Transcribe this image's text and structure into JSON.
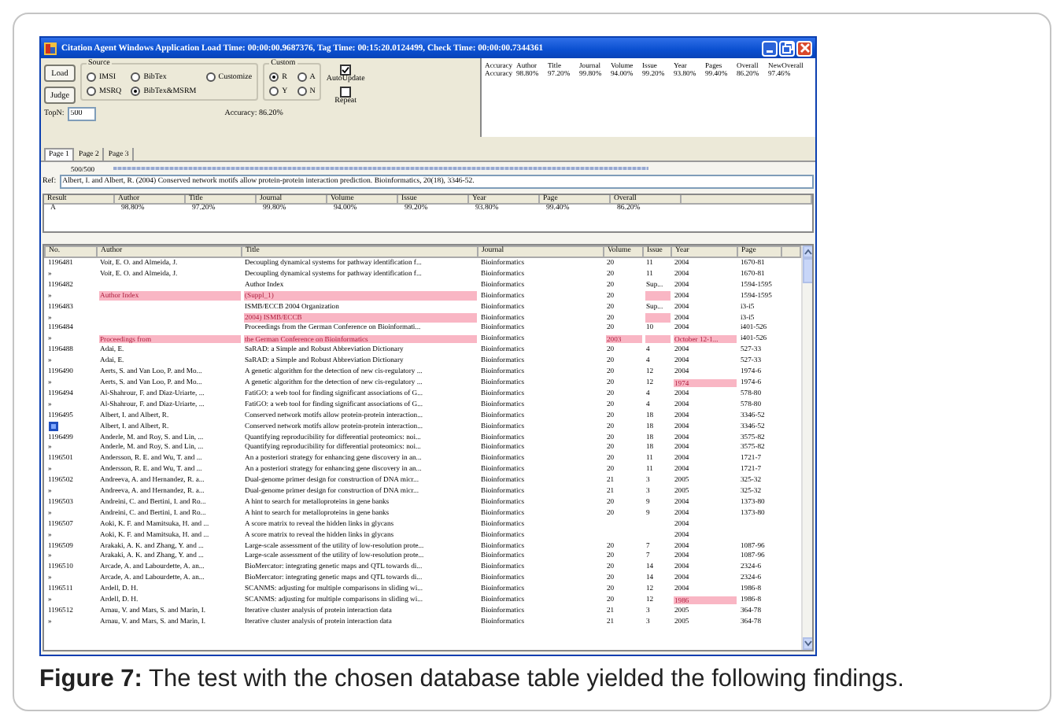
{
  "window": {
    "title": "Citation Agent Windows Application Load Time: 00:00:00.9687376, Tag Time: 00:15:20.0124499, Check Time: 00:00:00.7344361"
  },
  "controls": {
    "buttons": [
      "Load",
      "Judge"
    ],
    "source": {
      "label": "Source",
      "options": [
        {
          "label": "IMSI",
          "selected": false
        },
        {
          "label": "BibTex",
          "selected": false
        },
        {
          "label": "Customize",
          "selected": false
        },
        {
          "label": "MSRQ",
          "selected": false
        },
        {
          "label": "BibTex&MSRM",
          "selected": true
        }
      ]
    },
    "custom": {
      "label": "Custom",
      "options": [
        {
          "label": "R",
          "selected": true
        },
        {
          "label": "A",
          "selected": false
        },
        {
          "label": "Y",
          "selected": false
        },
        {
          "label": "N",
          "selected": false
        }
      ]
    },
    "checks": [
      {
        "label": "AutoUpdate",
        "checked": true
      },
      {
        "label": "Repeat",
        "checked": false
      }
    ],
    "topn": {
      "label": "TopN:",
      "value": "500"
    },
    "accuracy": "Accuracy: 86.20%"
  },
  "accuracy_panel": {
    "lines": [
      [
        "Accuracy",
        "Author",
        "Title",
        "Journal",
        "Volume",
        "Issue",
        "Year",
        "Pages",
        "Overall",
        "NewOverall"
      ],
      [
        "Accuracy",
        "98.80%",
        "97.20%",
        "99.80%",
        "94.00%",
        "99.20%",
        "93.80%",
        "99.40%",
        "86.20%",
        "97.46%"
      ]
    ]
  },
  "tabs": [
    {
      "label": "Page 1",
      "selected": true
    },
    {
      "label": "Page 2",
      "selected": false
    },
    {
      "label": "Page 3",
      "selected": false
    }
  ],
  "progress": {
    "reading": "500/500",
    "level": 1
  },
  "ref": {
    "label": "Ref:",
    "value": "Albert, I. and Albert, R. (2004) Conserved network motifs allow protein-protein interaction prediction. Bioinformatics, 20(18), 3346-52."
  },
  "result_table": {
    "columns": [
      "Result",
      "Author",
      "Title",
      "Journal",
      "Volume",
      "Issue",
      "Year",
      "Page",
      "Overall"
    ],
    "rows": [
      [
        "A",
        "98.80%",
        "97.20%",
        "99.80%",
        "94.00%",
        "99.20%",
        "93.80%",
        "99.40%",
        "86.20%"
      ]
    ]
  },
  "grid": {
    "columns": [
      "No.",
      "Author",
      "Title",
      "Journal",
      "Volume",
      "Issue",
      "Year",
      "Page"
    ],
    "rows": [
      {
        "cells": [
          "1196481",
          "Voit, E. O. and Almeida, J.",
          "Decoupling dynamical systems for pathway identification f...",
          "Bioinformatics",
          "20",
          "11",
          "2004",
          "1670-81"
        ],
        "current": false
      },
      {
        "cells": [
          "»",
          "Voit, E. O. and Almeida, J.",
          "Decoupling dynamical systems for pathway identification f...",
          "Bioinformatics",
          "20",
          "11",
          "2004",
          "1670-81"
        ],
        "current": false
      },
      {
        "cells": [
          "1196482",
          null,
          "Author Index",
          "Bioinformatics",
          "20",
          "Sup...",
          "2004",
          "1594-1595"
        ],
        "current": false
      },
      {
        "cells": [
          "»",
          {
            "text": "Author Index",
            "flagged": true
          },
          {
            "text": "(Suppl_1)",
            "flagged": true
          },
          "Bioinformatics",
          "20",
          {
            "flagged": true
          },
          "2004",
          "1594-1595"
        ],
        "current": false
      },
      {
        "cells": [
          "1196483",
          null,
          "ISMB/ECCB 2004 Organization",
          "Bioinformatics",
          "20",
          "Sup...",
          "2004",
          "i3-i5"
        ],
        "current": false
      },
      {
        "cells": [
          "»",
          null,
          {
            "text": "2004) ISMB/ECCB",
            "flagged": true
          },
          "Bioinformatics",
          "20",
          {
            "flagged": true
          },
          "2004",
          "i3-i5"
        ],
        "current": false
      },
      {
        "cells": [
          "1196484",
          null,
          "Proceedings from the German Conference on Bioinformati...",
          "Bioinformatics",
          "20",
          "10",
          "2004",
          "i401-526"
        ],
        "current": false
      },
      {
        "cells": [
          "»",
          {
            "text": "Proceedings from",
            "flagged": true
          },
          {
            "text": "the German Conference on Bioinformatics",
            "flagged": true
          },
          "Bioinformatics",
          {
            "text": "2003",
            "flagged": true
          },
          {
            "flagged": true
          },
          {
            "text": "October 12-1...",
            "flagged": true
          },
          "i401-526"
        ],
        "current": false
      },
      {
        "cells": [
          "1196488",
          "Adai, E.",
          "SaRAD: a Simple and Robust Abbreviation Dictionary",
          "Bioinformatics",
          "20",
          "4",
          "2004",
          "527-33"
        ],
        "current": false
      },
      {
        "cells": [
          "»",
          "Adai, E.",
          "SaRAD: a Simple and Robust Abbreviation Dictionary",
          "Bioinformatics",
          "20",
          "4",
          "2004",
          "527-33"
        ],
        "current": false
      },
      {
        "cells": [
          "1196490",
          "Aerts, S. and Van Loo, P. and Mo...",
          "A genetic algorithm for the detection of new cis-regulatory ...",
          "Bioinformatics",
          "20",
          "12",
          "2004",
          "1974-6"
        ],
        "current": false
      },
      {
        "cells": [
          "»",
          "Aerts, S. and Van Loo, P. and Mo...",
          "A genetic algorithm for the detection of new cis-regulatory ...",
          "Bioinformatics",
          "20",
          "12",
          {
            "text": "1974",
            "flagged": true
          },
          "1974-6"
        ],
        "current": false
      },
      {
        "cells": [
          "1196494",
          "Al-Shahrour, F. and Diaz-Uriarte, ...",
          "FatiGO: a web tool for finding significant associations of G...",
          "Bioinformatics",
          "20",
          "4",
          "2004",
          "578-80"
        ],
        "current": false
      },
      {
        "cells": [
          "»",
          "Al-Shahrour, F. and Diaz-Uriarte, ...",
          "FatiGO: a web tool for finding significant associations of G...",
          "Bioinformatics",
          "20",
          "4",
          "2004",
          "578-80"
        ],
        "current": false
      },
      {
        "cells": [
          "1196495",
          "Albert, I. and Albert, R.",
          "Conserved network motifs allow protein-protein interaction...",
          "Bioinformatics",
          "20",
          "18",
          "2004",
          "3346-52"
        ],
        "current": false
      },
      {
        "cells": [
          null,
          "Albert, I. and Albert, R.",
          "Conserved network motifs allow protein-protein interaction...",
          "Bioinformatics",
          "20",
          "18",
          "2004",
          "3346-52"
        ],
        "current": true
      },
      {
        "cells": [
          "1196499",
          "Anderle, M. and Roy, S. and Lin, ...",
          "Quantifying reproducibility for differential proteomics: noi...",
          "Bioinformatics",
          "20",
          "18",
          "2004",
          "3575-82"
        ],
        "current": false
      },
      {
        "cells": [
          "»",
          "Anderle, M. and Roy, S. and Lin, ...",
          "Quantifying reproducibility for differential proteomics: noi...",
          "Bioinformatics",
          "20",
          "18",
          "2004",
          "3575-82"
        ],
        "current": false
      },
      {
        "cells": [
          "1196501",
          "Andersson, R. E. and Wu, T. and ...",
          "An a posteriori strategy for enhancing gene discovery in an...",
          "Bioinformatics",
          "20",
          "11",
          "2004",
          "1721-7"
        ],
        "current": false
      },
      {
        "cells": [
          "»",
          "Andersson, R. E. and Wu, T. and ...",
          "An a posteriori strategy for enhancing gene discovery in an...",
          "Bioinformatics",
          "20",
          "11",
          "2004",
          "1721-7"
        ],
        "current": false
      },
      {
        "cells": [
          "1196502",
          "Andreeva, A. and Hernandez, R. a...",
          "Dual-genome primer design for construction of DNA micr...",
          "Bioinformatics",
          "21",
          "3",
          "2005",
          "325-32"
        ],
        "current": false
      },
      {
        "cells": [
          "»",
          "Andreeva, A. and Hernandez, R. a...",
          "Dual-genome primer design for construction of DNA micr...",
          "Bioinformatics",
          "21",
          "3",
          "2005",
          "325-32"
        ],
        "current": false
      },
      {
        "cells": [
          "1196503",
          "Andreini, C. and Bertini, I. and Ro...",
          "A hint to search for metalloproteins in gene banks",
          "Bioinformatics",
          "20",
          "9",
          "2004",
          "1373-80"
        ],
        "current": false
      },
      {
        "cells": [
          "»",
          "Andreini, C. and Bertini, I. and Ro...",
          "A hint to search for metalloproteins in gene banks",
          "Bioinformatics",
          "20",
          "9",
          "2004",
          "1373-80"
        ],
        "current": false
      },
      {
        "cells": [
          "1196507",
          "Aoki, K. F. and Mamitsuka, H. and ...",
          "A score matrix to reveal the hidden links in glycans",
          "Bioinformatics",
          null,
          null,
          "2004",
          null
        ],
        "current": false
      },
      {
        "cells": [
          "»",
          "Aoki, K. F. and Mamitsuka, H. and ...",
          "A score matrix to reveal the hidden links in glycans",
          "Bioinformatics",
          null,
          null,
          "2004",
          null
        ],
        "current": false
      },
      {
        "cells": [
          "1196509",
          "Arakaki, A. K. and Zhang, Y. and ...",
          "Large-scale assessment of the utility of low-resolution prote...",
          "Bioinformatics",
          "20",
          "7",
          "2004",
          "1087-96"
        ],
        "current": false
      },
      {
        "cells": [
          "»",
          "Arakaki, A. K. and Zhang, Y. and ...",
          "Large-scale assessment of the utility of low-resolution prote...",
          "Bioinformatics",
          "20",
          "7",
          "2004",
          "1087-96"
        ],
        "current": false
      },
      {
        "cells": [
          "1196510",
          "Arcade, A. and Labourdette, A. an...",
          "BioMercator: integrating genetic maps and QTL towards di...",
          "Bioinformatics",
          "20",
          "14",
          "2004",
          "2324-6"
        ],
        "current": false
      },
      {
        "cells": [
          "»",
          "Arcade, A. and Labourdette, A. an...",
          "BioMercator: integrating genetic maps and QTL towards di...",
          "Bioinformatics",
          "20",
          "14",
          "2004",
          "2324-6"
        ],
        "current": false
      },
      {
        "cells": [
          "1196511",
          "Ardell, D. H.",
          "SCANMS: adjusting for multiple comparisons in sliding wi...",
          "Bioinformatics",
          "20",
          "12",
          "2004",
          "1986-8"
        ],
        "current": false
      },
      {
        "cells": [
          "»",
          "Ardell, D. H.",
          "SCANMS: adjusting for multiple comparisons in sliding wi...",
          "Bioinformatics",
          "20",
          "12",
          {
            "text": "1986",
            "flagged": true
          },
          "1986-8"
        ],
        "current": false
      },
      {
        "cells": [
          "1196512",
          "Arnau, V. and Mars, S. and Marin, I.",
          "Iterative cluster analysis of protein interaction data",
          "Bioinformatics",
          "21",
          "3",
          "2005",
          "364-78"
        ],
        "current": false
      },
      {
        "cells": [
          "»",
          "Arnau, V. and Mars, S. and Marin, I.",
          "Iterative cluster analysis of protein interaction data",
          "Bioinformatics",
          "21",
          "3",
          "2005",
          "364-78"
        ],
        "current": false
      }
    ]
  },
  "caption": "**Figure 7:** The test with the chosen database table yielded the following findings."
}
